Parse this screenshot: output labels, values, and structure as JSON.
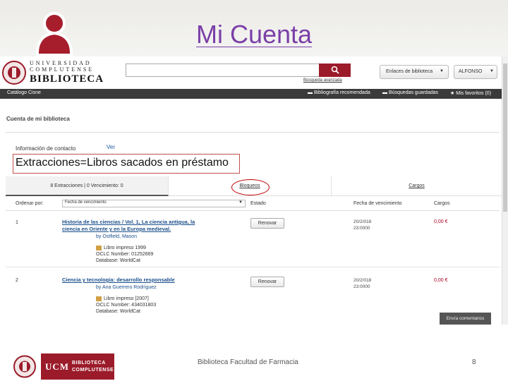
{
  "slide": {
    "title": "Mi Cuenta",
    "footer_text": "Biblioteca Facultad de Farmacia",
    "page_number": "8",
    "callout": "Extracciones=Libros sacados en préstamo"
  },
  "colors": {
    "title": "#7b3fa8",
    "brand": "#9b1b2a",
    "nav_bg": "#3b3b3b",
    "link": "#1a4f8b"
  },
  "header": {
    "logo_line1": "UNIVERSIDAD",
    "logo_line2": "COMPLUTENSE",
    "logo_line3": "BIBLIOTECA",
    "search_value": "",
    "advanced_search": "Búsqueda avanzada",
    "enlaces_label": "Enlaces de biblioteca",
    "user_label": "ALFONSO"
  },
  "nav": {
    "left": "Catálogo Cisne",
    "items": [
      "Bibliografía recomendada",
      "Búsquedas guardadas",
      "Mis favoritos (0)"
    ]
  },
  "account": {
    "heading": "Cuenta de mi biblioteca",
    "contact_label": "Información de contacto",
    "contact_link": "Ver"
  },
  "tabs": [
    {
      "label": "8 Extracciones | 0 Vencimiento: 0"
    },
    {
      "label": "Bloqueos"
    },
    {
      "label": "Cargos"
    }
  ],
  "table": {
    "sort_label": "Ordenar por:",
    "sort_value": "Fecha de vencimiento",
    "col_status": "Estado",
    "col_due": "Fecha de vencimiento",
    "col_charges": "Cargos",
    "renew_label": "Renovar",
    "rows": [
      {
        "n": "1",
        "title_l1": "Historia de las ciencias / Vol. 1, La ciencia antigua, la",
        "title_l2": "ciencia en Oriente y en la Europa medieval.",
        "author": "by Ostfield, Mason",
        "format": "Libro impreso 1999",
        "oclc": "OCLC Number: 01252669",
        "database": "Database: WorldCat",
        "due_l1": "20/2/018",
        "due_l2": "23:0000",
        "charge": "0,00 €"
      },
      {
        "n": "2",
        "title_l1": "Ciencia y tecnología: desarrollo responsable",
        "author": "by Ana Guerrero Rodríguez",
        "format": "Libro impreso [2007]",
        "oclc": "OCLC Number: 434031803",
        "database": "Database: WorldCat",
        "due_l1": "20/2/018",
        "due_l2": "23:0000",
        "charge": "0,00 €"
      }
    ]
  },
  "comments_button": "Envía comentarios",
  "footer_logo": {
    "ucm": "UCM",
    "line1": "BIBLIOTECA",
    "line2": "COMPLUTENSE"
  }
}
